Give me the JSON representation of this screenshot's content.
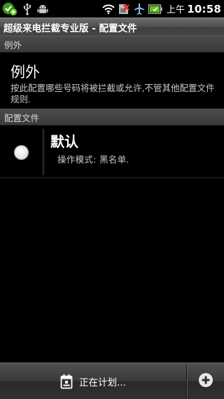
{
  "status_bar": {
    "ampm": "上午",
    "time": "10:58",
    "icons": [
      "app-notification-icon",
      "usb-icon",
      "android-debug-icon",
      "wifi-icon",
      "no-sim-icon",
      "airplane-icon",
      "battery-icon"
    ]
  },
  "title_bar": {
    "title": "超级来电拦截专业版 - 配置文件"
  },
  "sections": {
    "exceptions_header": "例外",
    "profiles_header": "配置文件"
  },
  "exception_item": {
    "title": "例外",
    "description": "按此配置哪些号码将被拦截或允许,不管其他配置文件规则."
  },
  "profile_item": {
    "name": "默认",
    "mode": "操作模式: 黑名单.",
    "selected": true
  },
  "bottom_bar": {
    "schedule_label": "正在计划...",
    "schedule_icon": "calendar-icon",
    "add_icon": "add-icon"
  },
  "colors": {
    "background": "#000000",
    "header_gray": "#3e3e3e",
    "notification_green": "#5fc21d"
  }
}
